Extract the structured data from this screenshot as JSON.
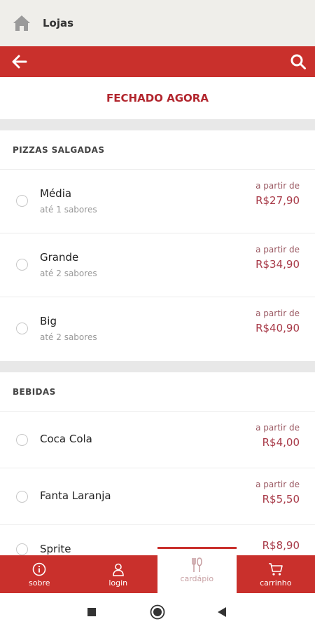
{
  "colors": {
    "brand_red": "#c9302c",
    "price_red": "#a83a48",
    "status_red": "#b2262e"
  },
  "header": {
    "title": "Lojas",
    "home_icon": "home-icon"
  },
  "toolbar": {
    "back_icon": "arrow-left-icon",
    "search_icon": "search-icon"
  },
  "status": {
    "label": "FECHADO AGORA"
  },
  "sections": [
    {
      "title": "PIZZAS SALGADAS",
      "items": [
        {
          "name": "Média",
          "subtitle": "até 1 sabores",
          "from_label": "a partir de",
          "price": "R$27,90"
        },
        {
          "name": "Grande",
          "subtitle": "até 2 sabores",
          "from_label": "a partir de",
          "price": "R$34,90"
        },
        {
          "name": "Big",
          "subtitle": "até 2 sabores",
          "from_label": "a partir de",
          "price": "R$40,90"
        }
      ]
    },
    {
      "title": "BEBIDAS",
      "items": [
        {
          "name": "Coca Cola",
          "from_label": "a partir de",
          "price": "R$4,00"
        },
        {
          "name": "Fanta Laranja",
          "from_label": "a partir de",
          "price": "R$5,50"
        },
        {
          "name": "Sprite",
          "price": "R$8,90"
        }
      ]
    }
  ],
  "tabs": [
    {
      "label": "sobre",
      "icon": "info-icon",
      "active": false
    },
    {
      "label": "login",
      "icon": "user-icon",
      "active": false
    },
    {
      "label": "cardápio",
      "icon": "cutlery-icon",
      "active": true
    },
    {
      "label": "carrinho",
      "icon": "cart-icon",
      "active": false
    }
  ],
  "system_nav": {
    "recents_icon": "square-icon",
    "home_icon": "circle-icon",
    "back_icon": "triangle-back-icon"
  }
}
